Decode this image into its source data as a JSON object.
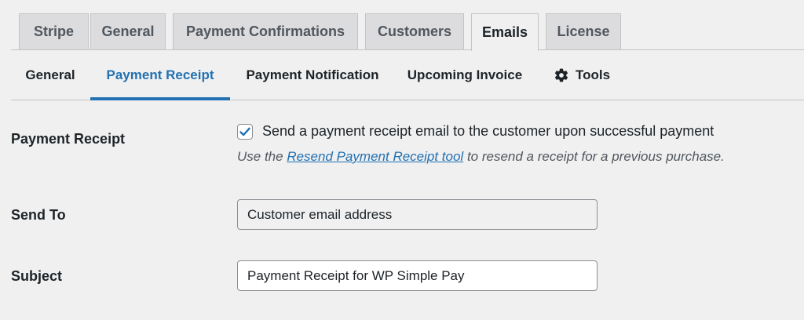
{
  "top_tabs": [
    {
      "label": "Stripe",
      "active": false
    },
    {
      "label": "General",
      "active": false
    },
    {
      "label": "Payment Confirmations",
      "active": false
    },
    {
      "label": "Customers",
      "active": false
    },
    {
      "label": "Emails",
      "active": true
    },
    {
      "label": "License",
      "active": false
    }
  ],
  "sub_tabs": [
    {
      "label": "General",
      "active": false
    },
    {
      "label": "Payment Receipt",
      "active": true
    },
    {
      "label": "Payment Notification",
      "active": false
    },
    {
      "label": "Upcoming Invoice",
      "active": false
    },
    {
      "label": "Tools",
      "active": false,
      "icon": "gear-icon"
    }
  ],
  "form": {
    "payment_receipt": {
      "label": "Payment Receipt",
      "checkbox_checked": true,
      "checkbox_label": "Send a payment receipt email to the customer upon successful payment",
      "desc_prefix": "Use the ",
      "desc_link": "Resend Payment Receipt tool",
      "desc_suffix": " to resend a receipt for a previous purchase."
    },
    "send_to": {
      "label": "Send To",
      "value": "Customer email address"
    },
    "subject": {
      "label": "Subject",
      "value": "Payment Receipt for WP Simple Pay"
    }
  },
  "colors": {
    "accent": "#2271b1",
    "checkbox_tick": "#2271b1",
    "background": "#f0f0f1"
  }
}
